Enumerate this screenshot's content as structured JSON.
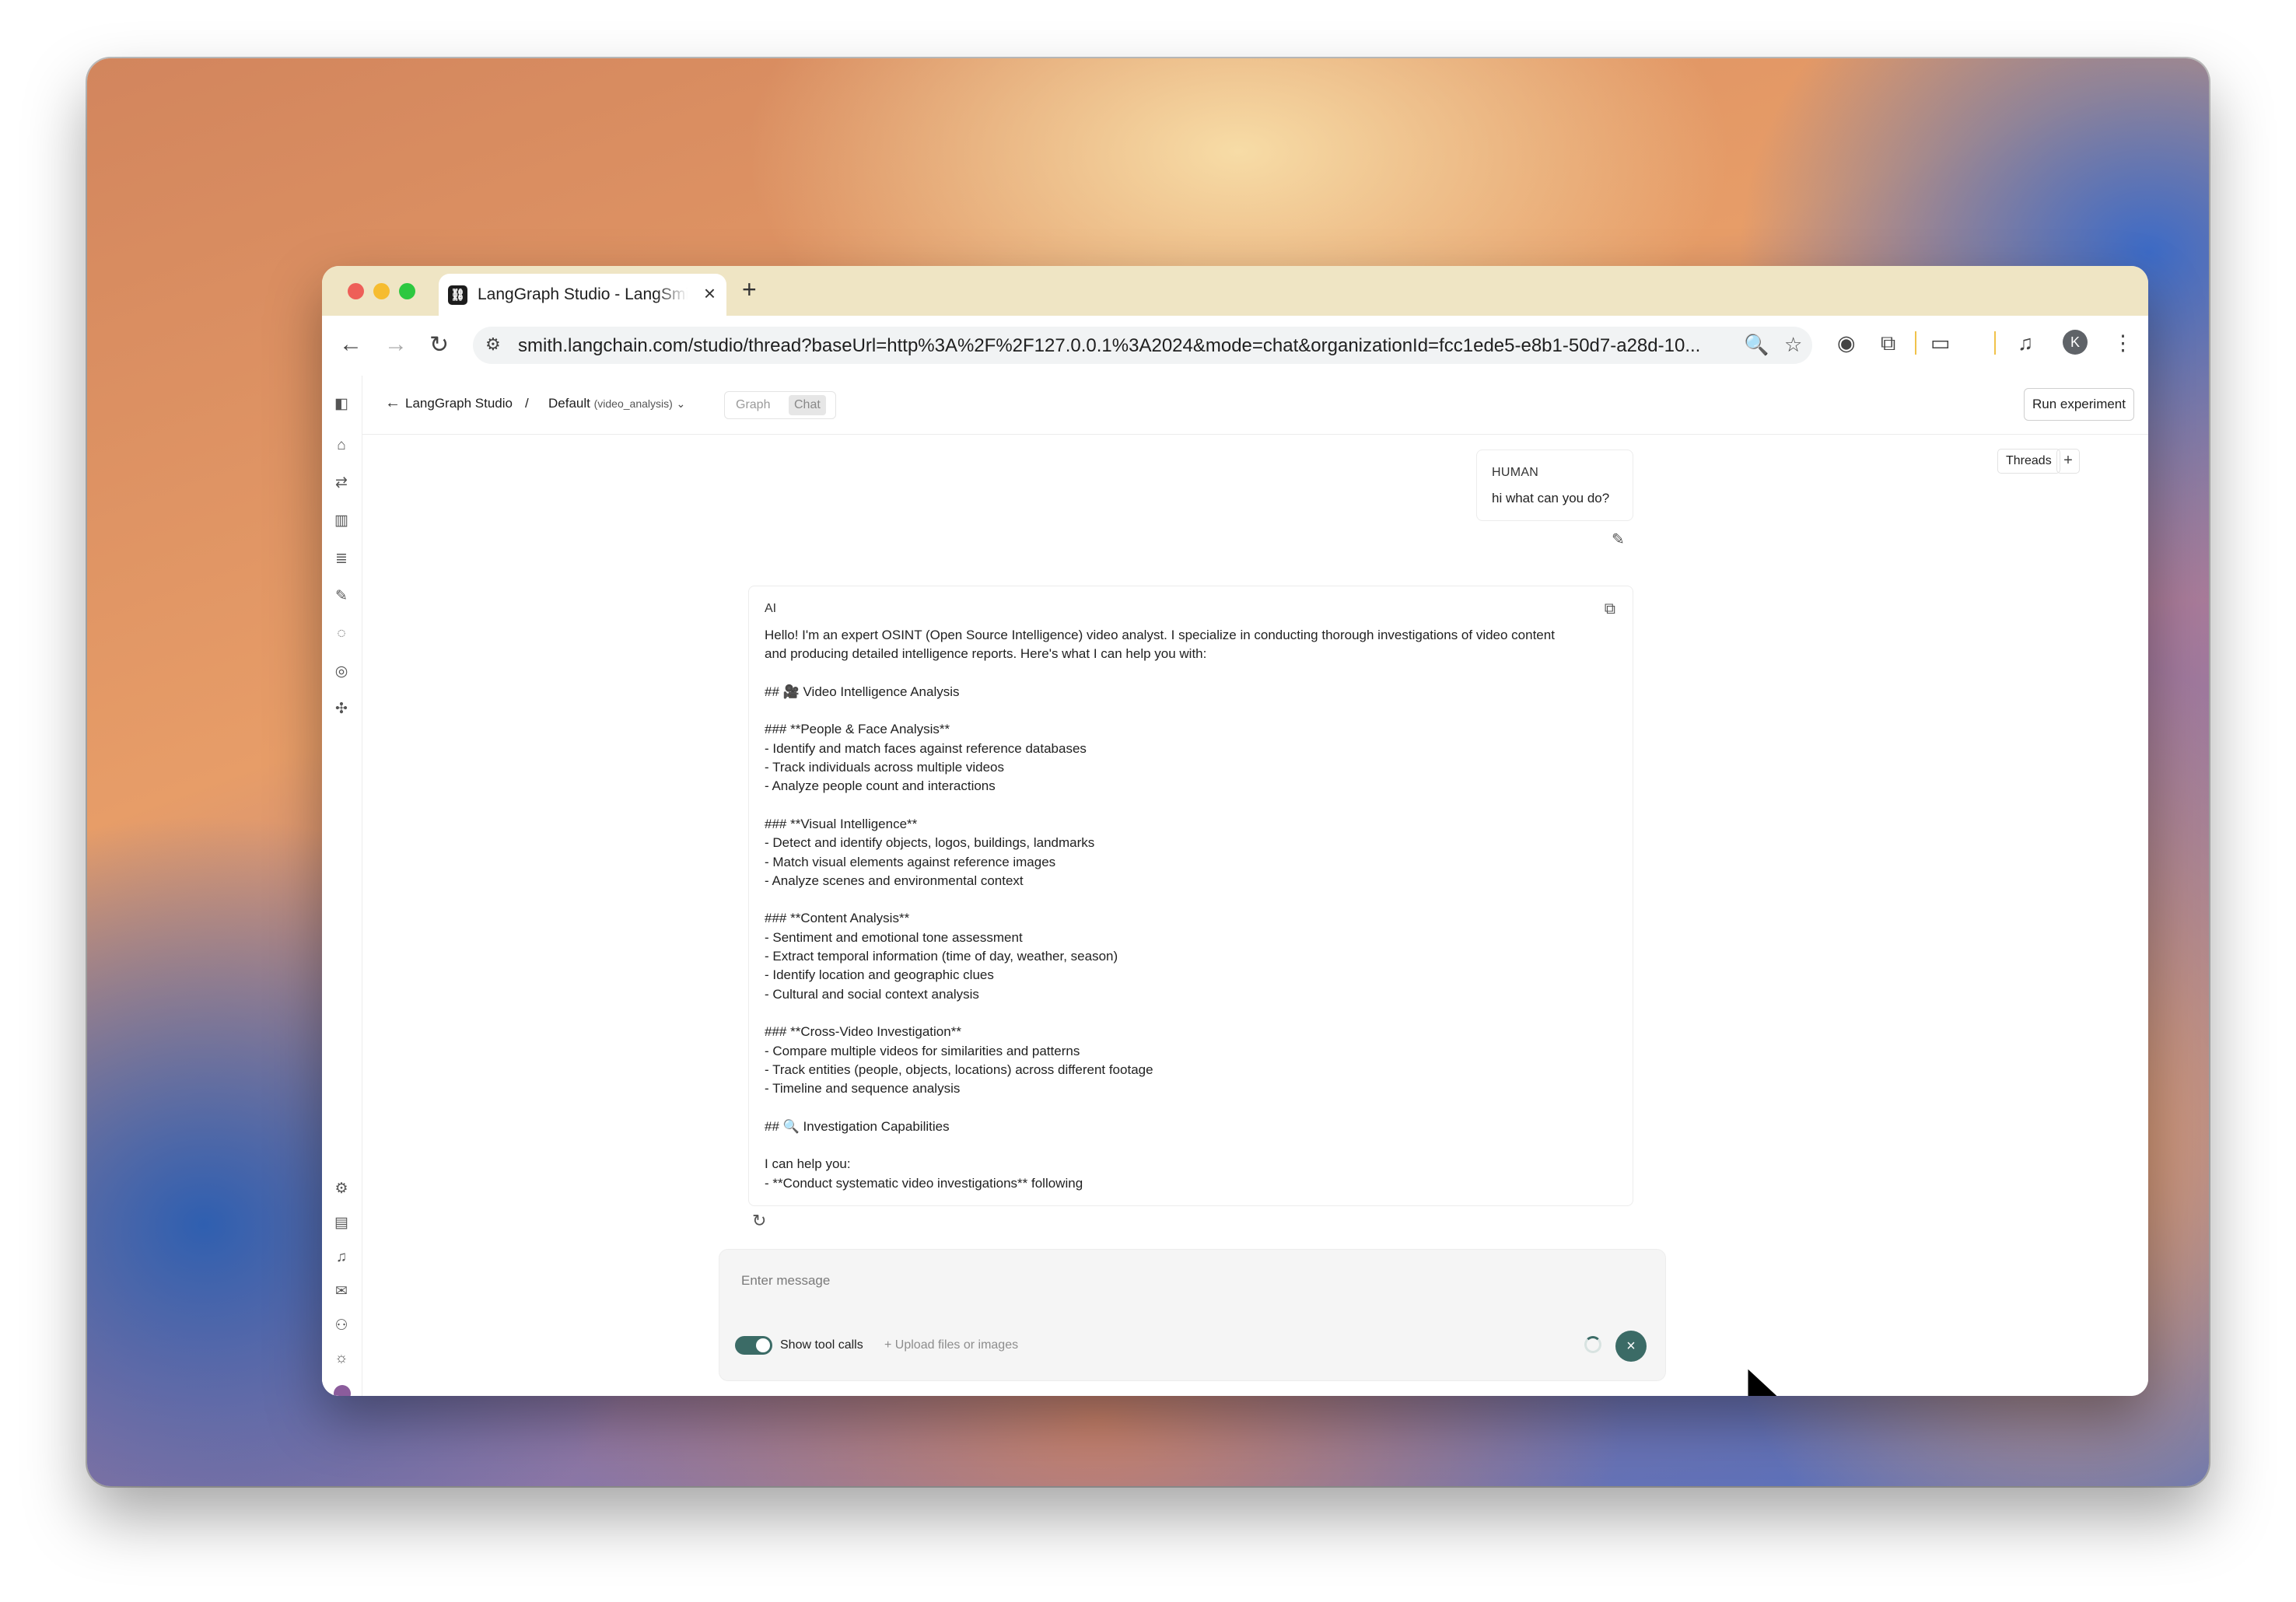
{
  "browser": {
    "tab_title": "LangGraph Studio - LangSmith",
    "tab_favicon": "langchain-logo",
    "close_label": "×",
    "new_tab_label": "+",
    "url": "smith.langchain.com/studio/thread?baseUrl=http%3A%2F%2F127.0.0.1%3A2024&mode=chat&organizationId=fcc1ede5-e8b1-50d7-a28d-10...",
    "profile_initial": "K"
  },
  "header": {
    "back_label": "LangGraph Studio",
    "separator": "/",
    "assistant_name": "Default",
    "assistant_graph": "(video_analysis)",
    "mode_graph": "Graph",
    "mode_chat": "Chat",
    "run_experiment": "Run experiment"
  },
  "threads": {
    "label": "Threads",
    "add_label": "+"
  },
  "messages": {
    "human": {
      "role": "HUMAN",
      "text": "hi what can you do?"
    },
    "ai": {
      "role": "AI",
      "text": "Hello! I'm an expert OSINT (Open Source Intelligence) video analyst. I specialize in conducting thorough investigations of video content\nand producing detailed intelligence reports. Here's what I can help you with:\n\n## 🎥 Video Intelligence Analysis\n\n### **People & Face Analysis**\n- Identify and match faces against reference databases\n- Track individuals across multiple videos\n- Analyze people count and interactions\n\n### **Visual Intelligence**\n- Detect and identify objects, logos, buildings, landmarks\n- Match visual elements against reference images\n- Analyze scenes and environmental context\n\n### **Content Analysis**\n- Sentiment and emotional tone assessment\n- Extract temporal information (time of day, weather, season)\n- Identify location and geographic clues\n- Cultural and social context analysis\n\n### **Cross-Video Investigation**\n- Compare multiple videos for similarities and patterns\n- Track entities (people, objects, locations) across different footage\n- Timeline and sequence analysis\n\n## 🔍 Investigation Capabilities\n\nI can help you:\n- **Conduct systematic video investigations** following"
    }
  },
  "composer": {
    "placeholder": "Enter message",
    "toggle_label": "Show tool calls",
    "toggle_on": true,
    "upload_label": "+  Upload files or images",
    "cancel_label": "×"
  },
  "colors": {
    "accent": "#3b6b66",
    "tabbar": "#efe5c4"
  },
  "sidebar_icons": [
    "panel-toggle-icon",
    "home-icon",
    "tracing-icon",
    "monitor-icon",
    "datasets-icon",
    "annotate-icon",
    "prompts-icon",
    "deployments-icon",
    "hub-icon"
  ],
  "sidebar_bottom_icons": [
    "settings-icon",
    "docs-icon",
    "notifications-icon",
    "inbox-icon",
    "add-user-icon",
    "theme-icon",
    "user-avatar"
  ]
}
